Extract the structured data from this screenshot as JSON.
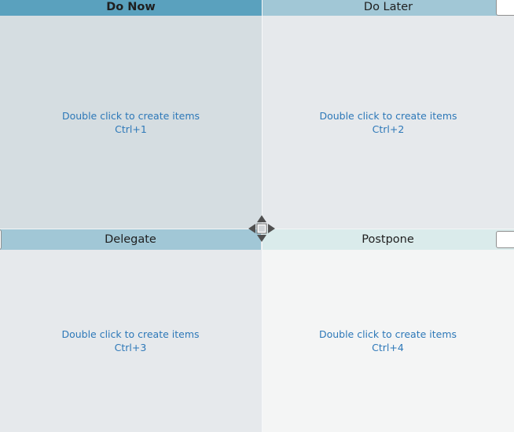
{
  "quadrants": [
    {
      "title": "Do Now",
      "hint_line1": "Double click to create items",
      "hint_line2": "Ctrl+1"
    },
    {
      "title": "Do Later",
      "hint_line1": "Double click to create items",
      "hint_line2": "Ctrl+2"
    },
    {
      "title": "Delegate",
      "hint_line1": "Double click to create items",
      "hint_line2": "Ctrl+3"
    },
    {
      "title": "Postpone",
      "hint_line1": "Double click to create items",
      "hint_line2": "Ctrl+4"
    }
  ],
  "colors": {
    "do_now_header": "#5aa1be",
    "do_later_header": "#a1c7d6",
    "delegate_header": "#a1c7d6",
    "postpone_header": "#daebeb",
    "hint_text": "#2d78b8"
  },
  "icons": {
    "center": "move-arrows-icon"
  }
}
